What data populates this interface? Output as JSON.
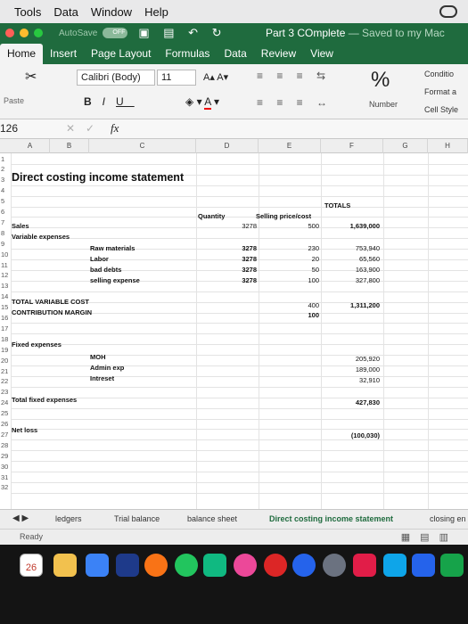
{
  "menubar": {
    "items": [
      "Tools",
      "Data",
      "Window",
      "Help"
    ]
  },
  "titlebar": {
    "autosave": "AutoSave",
    "toggle": "OFF",
    "doc_title": "Part 3 COmplete",
    "saved": "— Saved to my Mac"
  },
  "ribbon_tabs": [
    "Home",
    "Insert",
    "Page Layout",
    "Formulas",
    "Data",
    "Review",
    "View"
  ],
  "ribbon": {
    "paste": "Paste",
    "font": "Calibri (Body)",
    "size": "11",
    "grow_shrink": "A▴ A▾",
    "bold": "B",
    "italic": "I",
    "underline": "U",
    "percent": "%",
    "number": "Number",
    "conditional": "Conditio",
    "format_as": "Format a",
    "cell_styles": "Cell Style"
  },
  "formula_bar": {
    "name_box": "126",
    "fx": "fx",
    "value": ""
  },
  "columns": [
    "A",
    "B",
    "C",
    "D",
    "E",
    "F",
    "G",
    "H"
  ],
  "rows": [
    "1",
    "2",
    "3",
    "4",
    "5",
    "6",
    "7",
    "8",
    "9",
    "10",
    "11",
    "12",
    "13",
    "14",
    "15",
    "16",
    "17",
    "18",
    "19",
    "20",
    "21",
    "22",
    "23",
    "24",
    "25",
    "26",
    "27",
    "28",
    "29",
    "30",
    "31",
    "32"
  ],
  "sheet": {
    "title": "Direct costing income statement",
    "totals": "TOTALS",
    "quantity": "Quantity",
    "price_cost": "Selling price/cost",
    "sales": "Sales",
    "sales_qty": "3278",
    "sales_price": "500",
    "sales_total": "1,639,000",
    "variable_expenses": "Variable expenses",
    "raw_materials": "Raw materials",
    "labor": "Labor",
    "bad_debts": "bad debts",
    "selling_expense": "selling expense",
    "q8": "3278",
    "q9": "3278",
    "q10": "3278",
    "q11": "3278",
    "c8": "230",
    "c9": "20",
    "c10": "50",
    "c11": "100",
    "t8": "753,940",
    "t9": "65,560",
    "t10": "163,900",
    "t11": "327,800",
    "total_variable_cost": "TOTAL VARIABLE COST",
    "contribution_margin": "CONTRIBUTION MARGIN",
    "tvc_unit": "400",
    "tvc_total": "1,311,200",
    "cm_unit": "100",
    "fixed_expenses": "Fixed expenses",
    "moh": "MOH",
    "admin_exp": "Admin exp",
    "interest": "Intreset",
    "f18": "205,920",
    "f19": "189,000",
    "f20": "32,910",
    "total_fixed": "Total fixed expenses",
    "total_fixed_value": "427,830",
    "net_loss": "Net loss",
    "net_loss_value": "(100,030)"
  },
  "sheet_tabs": [
    "ledgers",
    "Trial balance",
    "balance sheet",
    "Direct costing income statement",
    "closing en"
  ],
  "active_sheet": "Direct costing income statement",
  "status": "Ready",
  "dock": {
    "calendar_day": "26"
  },
  "colors": {
    "excel_green": "#1f6b3e",
    "ribbon_bg": "#f3f3f3"
  }
}
